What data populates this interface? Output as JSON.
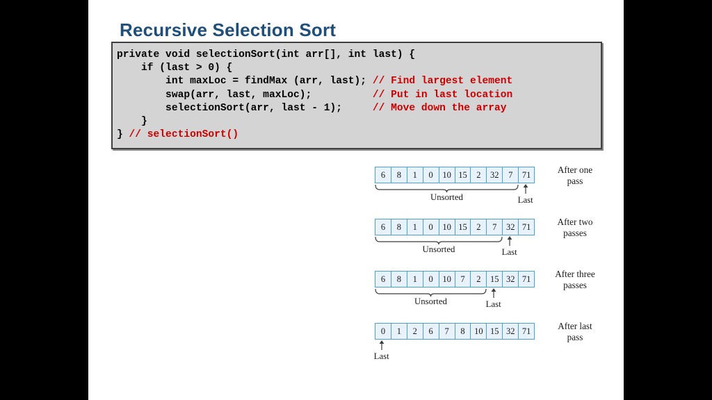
{
  "slide": {
    "title": "Recursive Selection Sort",
    "title_color": "#1f4e79",
    "background": "#ffffff",
    "letterbox_color": "#000000"
  },
  "code": {
    "background": "#d4d4d4",
    "border_color": "#3f3f3f",
    "text_color": "#000000",
    "comment_color": "#cc0000",
    "lines": [
      {
        "code": "private void selectionSort(int arr[], int last) {",
        "comment": ""
      },
      {
        "code": "    if (last > 0) {",
        "comment": ""
      },
      {
        "code": "        int maxLoc = findMax (arr, last); ",
        "comment": "// Find largest element"
      },
      {
        "code": "        swap(arr, last, maxLoc);          ",
        "comment": "// Put in last location"
      },
      {
        "code": "        selectionSort(arr, last - 1);     ",
        "comment": "// Move down the array"
      },
      {
        "code": "    }",
        "comment": ""
      },
      {
        "code": "} ",
        "comment": "// selectionSort()"
      }
    ]
  },
  "diagram": {
    "cell_fill": "#e8f2fb",
    "cell_border": "#4a9fd8",
    "unsorted_label": "Unsorted",
    "last_label": "Last",
    "rows": [
      {
        "values": [
          "6",
          "8",
          "1",
          "0",
          "10",
          "15",
          "2",
          "32",
          "7",
          "71"
        ],
        "pass_label": "After one\npass",
        "pass_label_line1": "After one",
        "pass_label_line2": "pass",
        "unsorted_count": 9,
        "last_index": 9,
        "show_brace": true
      },
      {
        "values": [
          "6",
          "8",
          "1",
          "0",
          "10",
          "15",
          "2",
          "7",
          "32",
          "71"
        ],
        "pass_label": "After two\npasses",
        "pass_label_line1": "After two",
        "pass_label_line2": "passes",
        "unsorted_count": 8,
        "last_index": 8,
        "show_brace": true
      },
      {
        "values": [
          "6",
          "8",
          "1",
          "0",
          "10",
          "7",
          "2",
          "15",
          "32",
          "71"
        ],
        "pass_label": "After three\npasses",
        "pass_label_line1": "After three",
        "pass_label_line2": "passes",
        "unsorted_count": 7,
        "last_index": 7,
        "show_brace": true
      },
      {
        "values": [
          "0",
          "1",
          "2",
          "6",
          "7",
          "8",
          "10",
          "15",
          "32",
          "71"
        ],
        "pass_label": "After last\npass",
        "pass_label_line1": "After last",
        "pass_label_line2": "pass",
        "unsorted_count": 0,
        "last_index": 0,
        "show_brace": false
      }
    ]
  }
}
